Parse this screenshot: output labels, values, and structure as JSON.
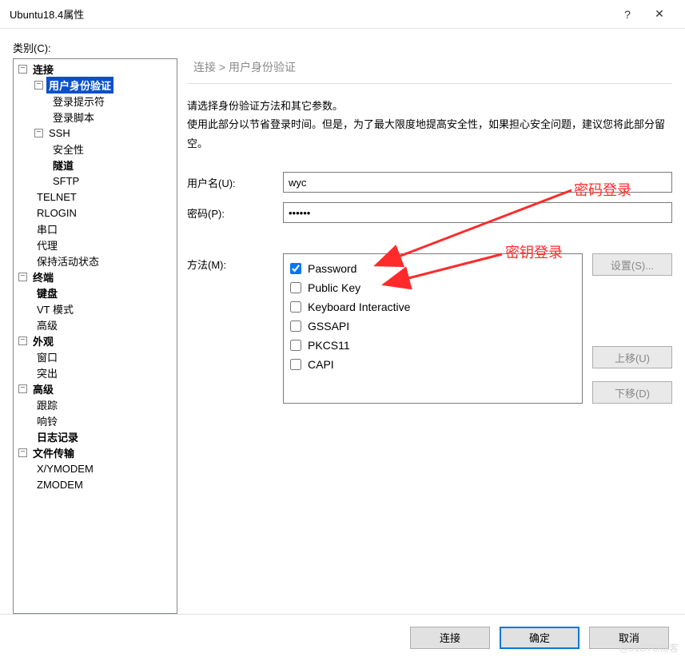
{
  "window": {
    "title": "Ubuntu18.4属性",
    "help": "?",
    "close": "✕"
  },
  "category_label": "类别(C):",
  "tree": {
    "connection": "连接",
    "user_auth": "用户身份验证",
    "login_prompt": "登录提示符",
    "login_script": "登录脚本",
    "ssh": "SSH",
    "security": "安全性",
    "tunnel": "隧道",
    "sftp": "SFTP",
    "telnet": "TELNET",
    "rlogin": "RLOGIN",
    "serial": "串口",
    "proxy": "代理",
    "keepalive": "保持活动状态",
    "terminal": "终端",
    "keyboard": "键盘",
    "vtmode": "VT 模式",
    "advanced1": "高级",
    "appearance": "外观",
    "window_item": "窗口",
    "highlight": "突出",
    "advanced2": "高级",
    "trace": "跟踪",
    "bell": "响铃",
    "logging": "日志记录",
    "file_transfer": "文件传输",
    "xymodem": "X/YMODEM",
    "zmodem": "ZMODEM"
  },
  "breadcrumb": "连接 > 用户身份验证",
  "desc_line1": "请选择身份验证方法和其它参数。",
  "desc_line2": "使用此部分以节省登录时间。但是，为了最大限度地提高安全性，如果担心安全问题，建议您将此部分留空。",
  "labels": {
    "username": "用户名(U):",
    "password": "密码(P):",
    "method": "方法(M):"
  },
  "values": {
    "username": "wyc",
    "password_mask": "••••••"
  },
  "methods": {
    "password": "Password",
    "publickey": "Public Key",
    "keyboard": "Keyboard Interactive",
    "gssapi": "GSSAPI",
    "pkcs11": "PKCS11",
    "capi": "CAPI"
  },
  "buttons": {
    "setup": "设置(S)...",
    "moveup": "上移(U)",
    "movedown": "下移(D)",
    "connect": "连接",
    "ok": "确定",
    "cancel": "取消"
  },
  "annotations": {
    "pwd_login": "密码登录",
    "key_login": "密钥登录"
  },
  "watermark": "@51CTO博客"
}
